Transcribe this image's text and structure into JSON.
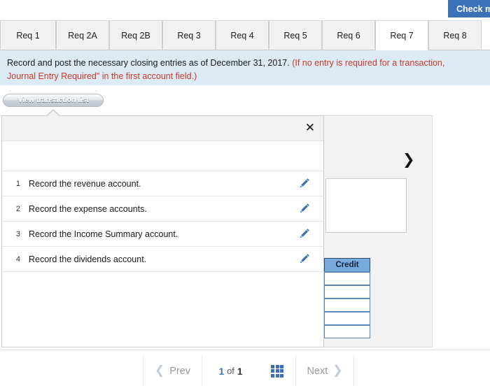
{
  "header": {
    "check_work_label": "Check my work"
  },
  "tabs": {
    "items": [
      {
        "label": "Req 1",
        "active": false
      },
      {
        "label": "Req 2A",
        "active": false
      },
      {
        "label": "Req 2B",
        "active": false
      },
      {
        "label": "Req 3",
        "active": false
      },
      {
        "label": "Req 4",
        "active": false
      },
      {
        "label": "Req 5",
        "active": false
      },
      {
        "label": "Req 6",
        "active": false
      },
      {
        "label": "Req 7",
        "active": true
      },
      {
        "label": "Req 8",
        "active": false
      }
    ]
  },
  "instruction": {
    "main": "Record and post the necessary closing entries as of December 31, 2017.",
    "hint_line1": "(If no entry is required for a transaction,",
    "hint_line2": "Journal Entry Required\" in the first account field.)"
  },
  "toolbar": {
    "view_transaction_list_label": "View transaction list"
  },
  "modal": {
    "close_label": "✕",
    "transactions": [
      {
        "num": "1",
        "text": "Record the revenue account.",
        "edit_icon": "pencil-icon"
      },
      {
        "num": "2",
        "text": "Record the expense accounts.",
        "edit_icon": "pencil-icon"
      },
      {
        "num": "3",
        "text": "Record the Income Summary account.",
        "edit_icon": "pencil-icon"
      },
      {
        "num": "4",
        "text": "Record the dividends account.",
        "edit_icon": "pencil-icon"
      }
    ]
  },
  "journal": {
    "next_arrow": "❯",
    "credit_header": "Credit",
    "credit_rows": [
      "",
      "",
      "",
      "",
      ""
    ]
  },
  "pagination": {
    "prev_label": "Prev",
    "prev_icon": "chevron-left-icon",
    "current_page": "1",
    "of_label": "of",
    "total_pages": "1",
    "grid_icon": "grid-view-icon",
    "next_label": "Next",
    "next_icon": "chevron-right-icon"
  },
  "colors": {
    "accent_blue": "#3a72b8",
    "banner_blue": "#dceaf4",
    "hint_red": "#c9392c",
    "credit_header_blue": "#77aadd",
    "pencil_blue": "#3c6fb4"
  }
}
